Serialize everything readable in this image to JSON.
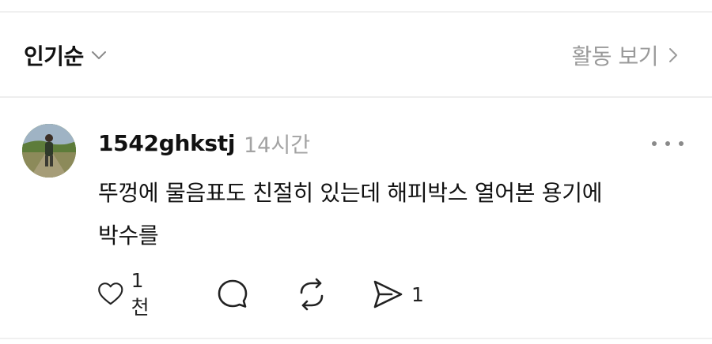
{
  "sort": {
    "label": "인기순",
    "icon": "chevron-down-icon"
  },
  "activity": {
    "label": "활동 보기",
    "icon": "chevron-right-icon"
  },
  "comment": {
    "username": "1542ghkstj",
    "time": "14시간",
    "text_line1": "뚜껑에 물음표도 친절히 있는데 해피박스 열어본 용기에",
    "text_line2": "박수를",
    "likes": "1천",
    "shares": "1"
  },
  "colors": {
    "text_primary": "#111111",
    "text_secondary": "#9a9a9a",
    "divider": "#eeeeee",
    "icon": "#222222"
  }
}
